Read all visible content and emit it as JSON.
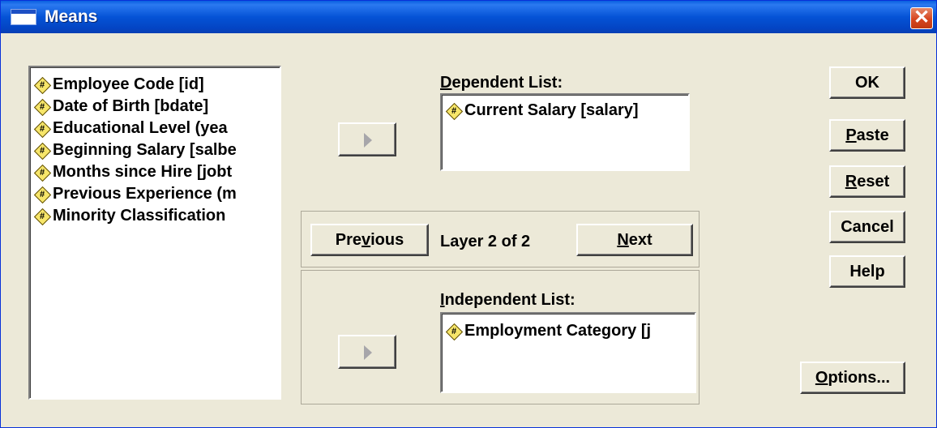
{
  "window": {
    "title": "Means",
    "close_glyph": "✕"
  },
  "variables": [
    "Employee Code [id]",
    "Date of Birth [bdate]",
    "Educational Level (yea",
    "Beginning Salary [salbe",
    "Months since Hire [jobt",
    "Previous Experience (m",
    "Minority Classification"
  ],
  "dependent": {
    "label_first": "D",
    "label_rest": "ependent List:",
    "items": [
      "Current Salary [salary]"
    ]
  },
  "layer": {
    "prev_a": "Pre",
    "prev_u": "v",
    "prev_b": "ious",
    "text": "Layer 2 of 2",
    "next_u": "N",
    "next_b": "ext"
  },
  "independent": {
    "label_first": "I",
    "label_rest": "ndependent List:",
    "items": [
      "Employment Category [j"
    ]
  },
  "buttons": {
    "ok": "OK",
    "paste_u": "P",
    "paste_b": "aste",
    "reset_u": "R",
    "reset_b": "eset",
    "cancel": "Cancel",
    "help": "Help",
    "options_u": "O",
    "options_b": "ptions..."
  },
  "icons": {
    "variable": "scale-variable-icon",
    "arrow": "right-arrow-icon"
  },
  "colors": {
    "titlebar": "#0553d6",
    "dialog_bg": "#ece9d8",
    "close_button": "#d6451f",
    "variable_icon": "#f7e66a"
  }
}
